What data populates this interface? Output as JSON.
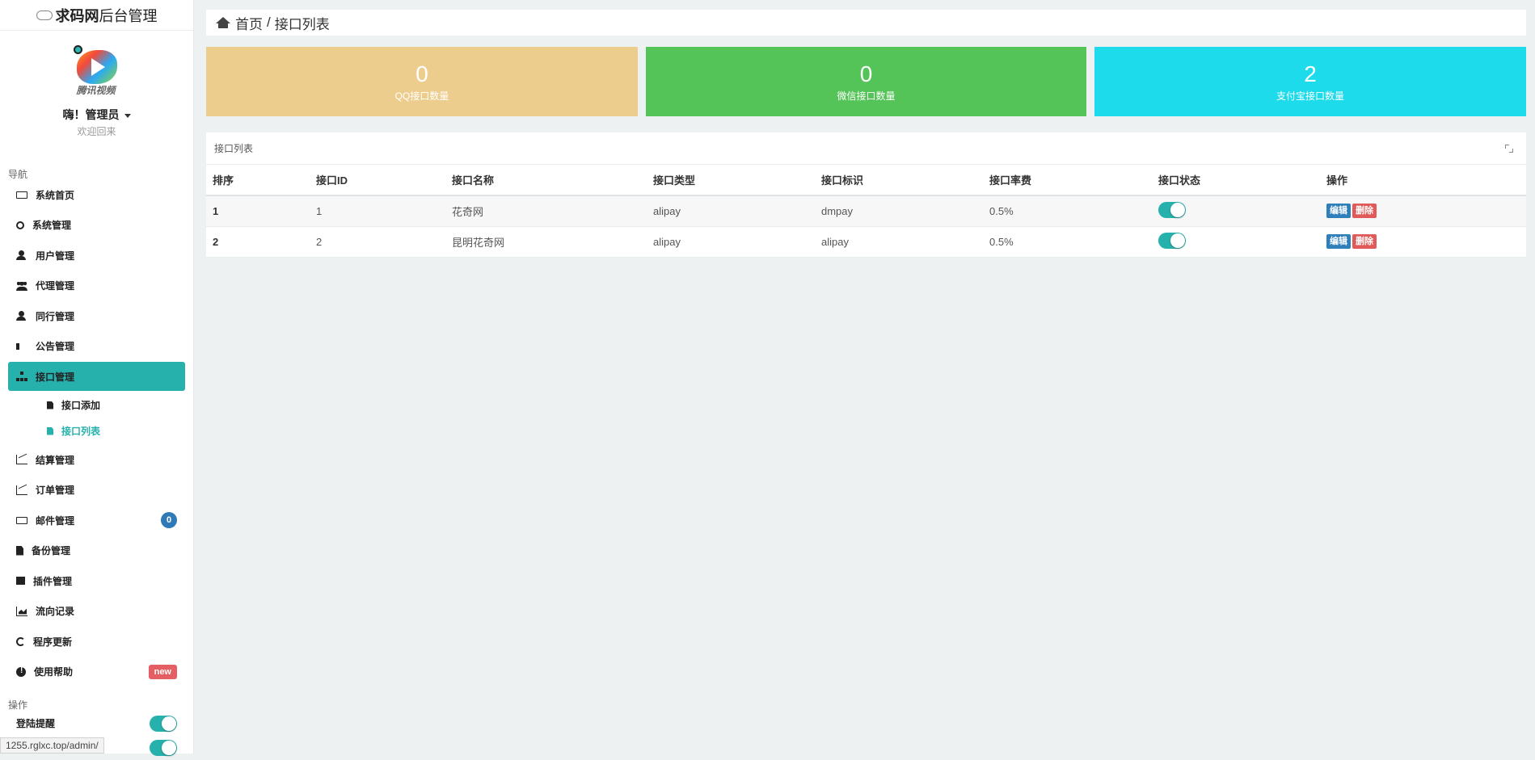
{
  "brand": {
    "bold": "求码网",
    "rest": "后台管理"
  },
  "profile": {
    "avatar_caption": "腾讯视频",
    "greeting": "嗨！管理员",
    "welcome": "欢迎回来"
  },
  "nav": {
    "heading": "导航",
    "items": [
      {
        "label": "系统首页",
        "icon": "monitor-icon"
      },
      {
        "label": "系统管理",
        "icon": "gears-icon"
      },
      {
        "label": "用户管理",
        "icon": "user-icon"
      },
      {
        "label": "代理管理",
        "icon": "users-icon"
      },
      {
        "label": "同行管理",
        "icon": "user-icon"
      },
      {
        "label": "公告管理",
        "icon": "speaker-icon"
      },
      {
        "label": "接口管理",
        "icon": "sitemap-icon",
        "active": true
      },
      {
        "label": "结算管理",
        "icon": "line-chart-icon"
      },
      {
        "label": "订单管理",
        "icon": "bar-chart-icon"
      },
      {
        "label": "邮件管理",
        "icon": "envelope-icon",
        "badge": "0"
      },
      {
        "label": "备份管理",
        "icon": "file-icon"
      },
      {
        "label": "插件管理",
        "icon": "puzzle-icon"
      },
      {
        "label": "流向记录",
        "icon": "area-chart-icon"
      },
      {
        "label": "程序更新",
        "icon": "sync-icon"
      },
      {
        "label": "使用帮助",
        "icon": "info-icon",
        "badge": "new"
      }
    ],
    "submenu": [
      {
        "label": "接口添加"
      },
      {
        "label": "接口列表",
        "current": true
      }
    ]
  },
  "ops": {
    "heading": "操作",
    "items": [
      {
        "label": "登陆提醒",
        "on": true
      },
      {
        "label": "",
        "on": true
      }
    ]
  },
  "statusbar": {
    "url": "1255.rglxc.top/admin/"
  },
  "breadcrumb": {
    "home": "首页",
    "separator": "/",
    "current": "接口列表"
  },
  "stats": [
    {
      "value": "0",
      "label": "QQ接口数量",
      "color": "#edcd8e"
    },
    {
      "value": "0",
      "label": "微信接口数量",
      "color": "#55c458"
    },
    {
      "value": "2",
      "label": "支付宝接口数量",
      "color": "#1edbec"
    }
  ],
  "table": {
    "title": "接口列表",
    "columns": [
      "排序",
      "接口ID",
      "接口名称",
      "接口类型",
      "接口标识",
      "接口率费",
      "接口状态",
      "操作"
    ],
    "rows": [
      {
        "rank": "1",
        "id": "1",
        "name": "花奇网",
        "type": "alipay",
        "tag": "dmpay",
        "rate": "0.5%",
        "enabled": true
      },
      {
        "rank": "2",
        "id": "2",
        "name": "昆明花奇网",
        "type": "alipay",
        "tag": "alipay",
        "rate": "0.5%",
        "enabled": true
      }
    ],
    "edit_label": "编辑",
    "delete_label": "删除"
  },
  "colors": {
    "accent": "#26b1ac",
    "edit": "#2f7fbb",
    "delete": "#e05a5a",
    "badge_blue": "#2e79b6",
    "badge_red": "#e55f62"
  }
}
